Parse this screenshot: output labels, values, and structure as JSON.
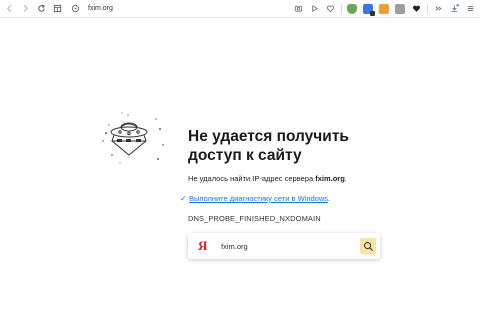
{
  "browser": {
    "url": "fxim.org",
    "icons": [
      "back-icon",
      "forward-icon",
      "reload-icon",
      "tabs-icon",
      "site-info-icon",
      "screenshot-icon",
      "play-icon",
      "heart-icon",
      "extension-icons",
      "menu-icon"
    ]
  },
  "error": {
    "title_line1": "Не удается получить",
    "title_line2": "доступ к сайту",
    "message_prefix": "Не удалось найти IP-адрес сервера ",
    "message_host": "fxim.org",
    "message_suffix": ".",
    "diagnostics_link": "Выполните диагностику сети в Windows",
    "diagnostics_suffix": ".",
    "code": "DNS_PROBE_FINISHED_NXDOMAIN"
  },
  "search": {
    "logo": "Я",
    "value": "fxim.org"
  },
  "colors": {
    "link": "#1a73e8",
    "yandex_red": "#e8201c",
    "search_button": "#fde3a0"
  }
}
